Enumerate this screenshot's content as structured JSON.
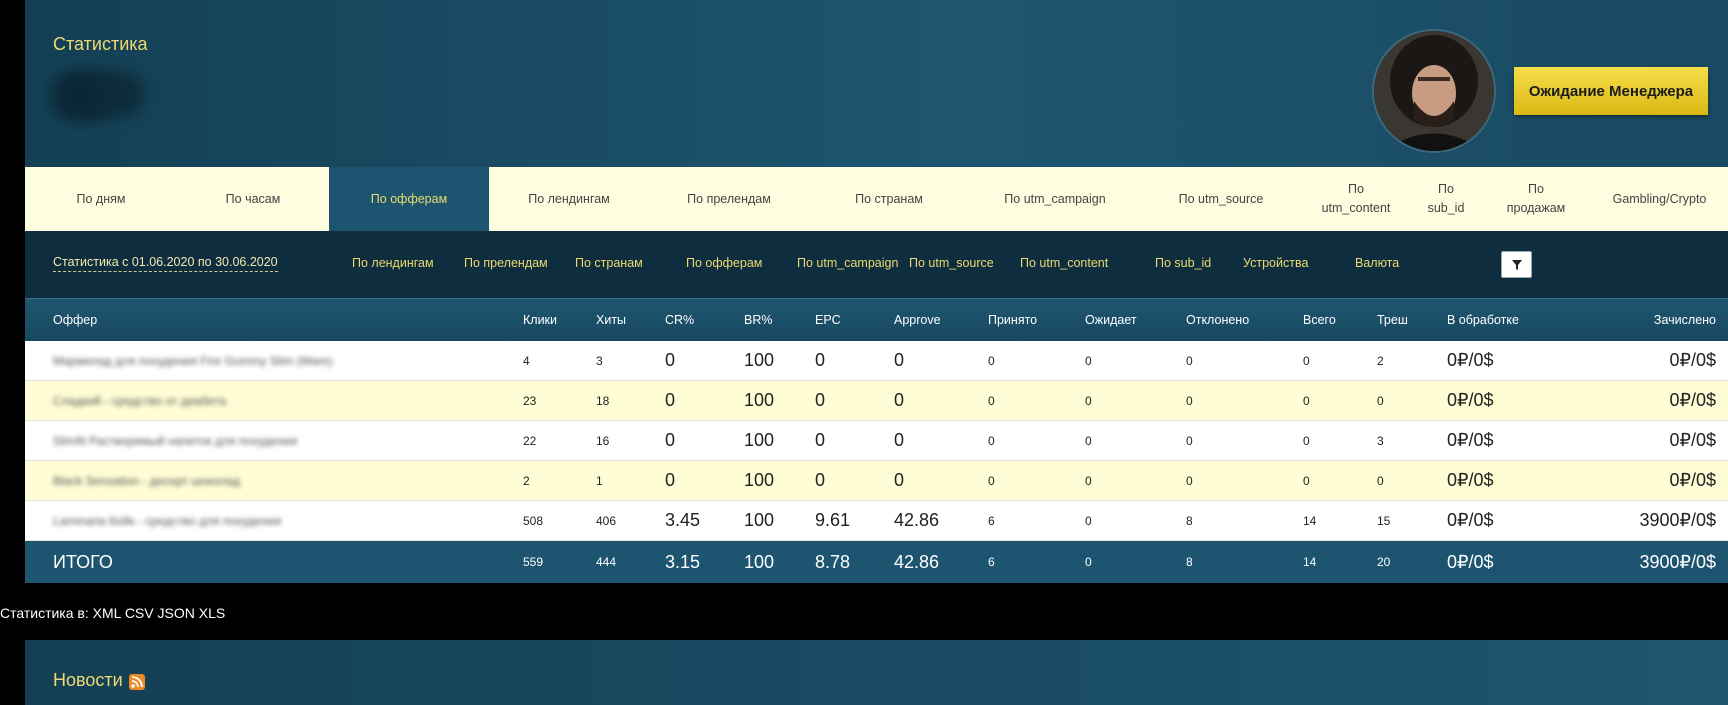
{
  "header": {
    "title": "Статистика",
    "manager_button": "Ожидание Менеджера"
  },
  "tabs": [
    {
      "label": "По дням"
    },
    {
      "label": "По часам"
    },
    {
      "label": "По офферам",
      "active": true
    },
    {
      "label": "По лендингам"
    },
    {
      "label": "По прелендам"
    },
    {
      "label": "По странам"
    },
    {
      "label": "По utm_campaign"
    },
    {
      "label": "По utm_source"
    },
    {
      "label": "По utm_content"
    },
    {
      "label": "По sub_id"
    },
    {
      "label": "По продажам"
    },
    {
      "label": "Gambling/Crypto"
    }
  ],
  "filters": {
    "period": "Статистика с 01.06.2020 по 30.06.2020",
    "links": [
      "По лендингам",
      "По прелендам",
      "По странам",
      "По офферам",
      "По utm_campaign",
      "По utm_source",
      "По utm_content",
      "По sub_id",
      "Устройства",
      "Валюта"
    ]
  },
  "table": {
    "headers": [
      "Оффер",
      "Клики",
      "Хиты",
      "CR%",
      "BR%",
      "EPC",
      "Approve",
      "Принято",
      "Ожидает",
      "Отклонено",
      "Всего",
      "Треш",
      "В обработке",
      "Зачислено"
    ],
    "rows": [
      {
        "offer": "Мармелад для похудения Fire Gummy Slim (Ware)",
        "clicks": "4",
        "hits": "3",
        "cr": "0",
        "br": "100",
        "epc": "0",
        "approve": "0",
        "accepted": "0",
        "pending": "0",
        "rejected": "0",
        "total": "0",
        "trash": "2",
        "processing": "0₽/0$",
        "credited": "0₽/0$"
      },
      {
        "offer": "Сладкий - средство от диабета",
        "clicks": "23",
        "hits": "18",
        "cr": "0",
        "br": "100",
        "epc": "0",
        "approve": "0",
        "accepted": "0",
        "pending": "0",
        "rejected": "0",
        "total": "0",
        "trash": "0",
        "processing": "0₽/0$",
        "credited": "0₽/0$"
      },
      {
        "offer": "Slimfit Растворимый напиток для похудения",
        "clicks": "22",
        "hits": "16",
        "cr": "0",
        "br": "100",
        "epc": "0",
        "approve": "0",
        "accepted": "0",
        "pending": "0",
        "rejected": "0",
        "total": "0",
        "trash": "3",
        "processing": "0₽/0$",
        "credited": "0₽/0$"
      },
      {
        "offer": "Black Sensation - десерт шоколад",
        "clicks": "2",
        "hits": "1",
        "cr": "0",
        "br": "100",
        "epc": "0",
        "approve": "0",
        "accepted": "0",
        "pending": "0",
        "rejected": "0",
        "total": "0",
        "trash": "0",
        "processing": "0₽/0$",
        "credited": "0₽/0$"
      },
      {
        "offer": "Laminaria Кейк - средство для похудения",
        "clicks": "508",
        "hits": "406",
        "cr": "3.45",
        "br": "100",
        "epc": "9.61",
        "approve": "42.86",
        "accepted": "6",
        "pending": "0",
        "rejected": "8",
        "total": "14",
        "trash": "15",
        "processing": "0₽/0$",
        "credited": "3900₽/0$"
      }
    ],
    "totals": {
      "label": "ИТОГО",
      "clicks": "559",
      "hits": "444",
      "cr": "3.15",
      "br": "100",
      "epc": "8.78",
      "approve": "42.86",
      "accepted": "6",
      "pending": "0",
      "rejected": "8",
      "total": "14",
      "trash": "20",
      "processing": "0₽/0$",
      "credited": "3900₽/0$"
    }
  },
  "export": {
    "label": "Статистика в:",
    "formats": [
      "XML",
      "CSV",
      "JSON",
      "XLS"
    ]
  },
  "news": {
    "title": "Новости"
  }
}
